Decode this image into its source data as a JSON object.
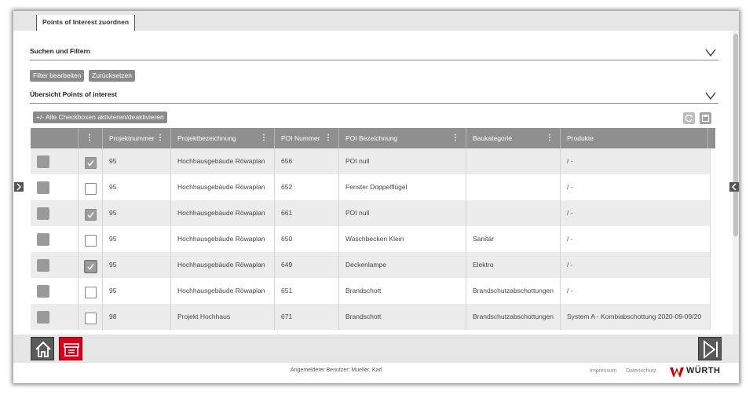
{
  "tab": {
    "label": "Points of Interest zuordnen"
  },
  "search_section": {
    "title": "Suchen und Filtern"
  },
  "buttons": {
    "edit_filter": "Filter bearbeiten",
    "reset": "Zurücksetzen",
    "toggle_all": "+/- Alle Checkboxen aktivieren/deaktivieren"
  },
  "overview_section": {
    "title": "Übersicht Points of interest"
  },
  "table": {
    "headers": [
      "Projektnummer",
      "Projektbezeichnung",
      "POI Nummer",
      "POI Bezeichnung",
      "Baukategorie",
      "Produkte"
    ],
    "rows": [
      {
        "checked": true,
        "projektnummer": "95",
        "projektbezeichnung": "Hochhausgebäude Röwaplan",
        "poi_nummer": "656",
        "poi_bezeichnung": "POI null",
        "baukategorie": "",
        "produkte": "/ -"
      },
      {
        "checked": false,
        "projektnummer": "95",
        "projektbezeichnung": "Hochhausgebäude Röwaplan",
        "poi_nummer": "652",
        "poi_bezeichnung": "Fenster Doppelflügel",
        "baukategorie": "",
        "produkte": "/ -"
      },
      {
        "checked": true,
        "projektnummer": "95",
        "projektbezeichnung": "Hochhausgebäude Röwaplan",
        "poi_nummer": "661",
        "poi_bezeichnung": "POI null",
        "baukategorie": "",
        "produkte": "/ -"
      },
      {
        "checked": false,
        "projektnummer": "95",
        "projektbezeichnung": "Hochhausgebäude Röwaplan",
        "poi_nummer": "650",
        "poi_bezeichnung": "Waschbecken Klein",
        "baukategorie": "Sanitär",
        "produkte": "/ -"
      },
      {
        "checked": true,
        "projektnummer": "95",
        "projektbezeichnung": "Hochhausgebäude Röwaplan",
        "poi_nummer": "649",
        "poi_bezeichnung": "Deckenlampe",
        "baukategorie": "Elektro",
        "produkte": "/ -"
      },
      {
        "checked": false,
        "projektnummer": "95",
        "projektbezeichnung": "Hochhausgebäude Röwaplan",
        "poi_nummer": "651",
        "poi_bezeichnung": "Brandschott",
        "baukategorie": "Brandschutzabschottungen",
        "produkte": "/ -"
      },
      {
        "checked": false,
        "projektnummer": "98",
        "projektbezeichnung": "Projekt Hochhaus",
        "poi_nummer": "671",
        "poi_bezeichnung": "Brandschott",
        "baukategorie": "Brandschutzabschottungen",
        "produkte": "System A - Kombiabschottung 2020-09-09/20"
      }
    ]
  },
  "footer": {
    "user": "Angemeldeter Benutzer: Mueller, Karl",
    "impressum": "Impressum",
    "datenschutz": "Datenschutz",
    "logo": "WÜRTH"
  },
  "colors": {
    "accent": "#cc0000",
    "header_gray": "#8f8f8f"
  }
}
